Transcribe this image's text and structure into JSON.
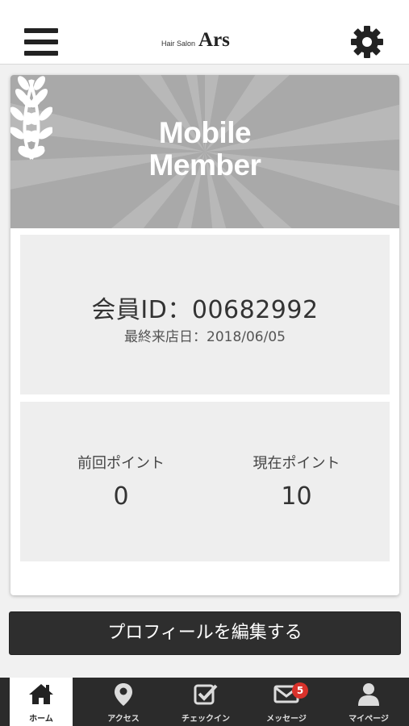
{
  "header": {
    "brand_small": "Hair Salon",
    "brand_main": "Ars",
    "menu_icon": "hamburger-menu-icon",
    "settings_icon": "gear-icon"
  },
  "banner": {
    "title_line1": "Mobile",
    "title_line2": "Member",
    "background_color": "#a9a9a9"
  },
  "member": {
    "id_text": "会員ID：00682992",
    "last_visit_text": "最終来店日：2018/06/05"
  },
  "points": {
    "previous_label": "前回ポイント",
    "previous_value": "0",
    "current_label": "現在ポイント",
    "current_value": "10"
  },
  "edit_profile_button": "プロフィールを編集する",
  "tabbar": {
    "tabs": [
      {
        "label": "ホーム",
        "icon": "home-icon",
        "active": true
      },
      {
        "label": "アクセス",
        "icon": "map-pin-icon",
        "active": false
      },
      {
        "label": "チェックイン",
        "icon": "checkbox-icon",
        "active": false
      },
      {
        "label": "メッセージ",
        "icon": "envelope-icon",
        "active": false
      },
      {
        "label": "マイページ",
        "icon": "user-icon",
        "active": false
      }
    ],
    "message_badge": "5",
    "badge_color": "#d9322b"
  }
}
